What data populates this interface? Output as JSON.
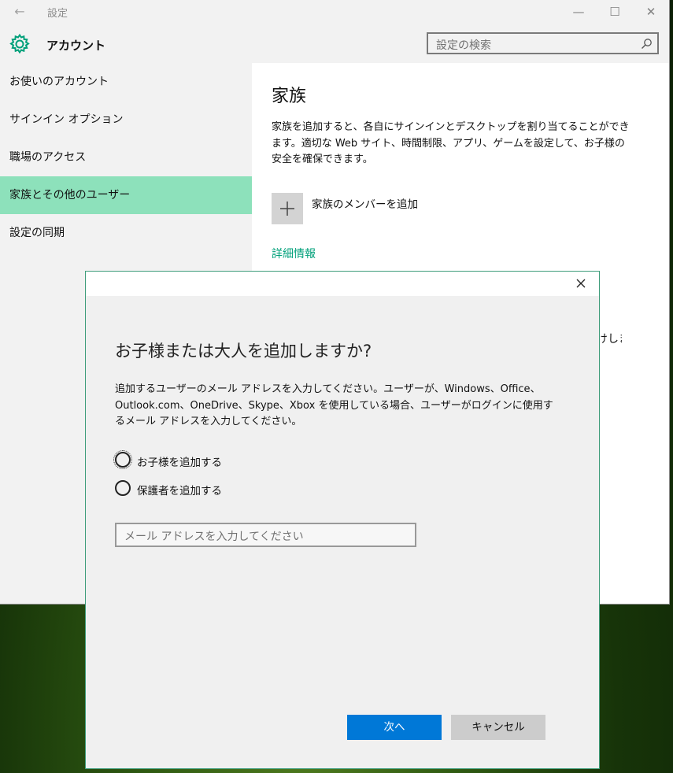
{
  "window": {
    "title": "設定",
    "back_icon": "back-arrow-icon",
    "controls": [
      "minimize-icon",
      "maximize-icon",
      "close-icon"
    ]
  },
  "header": {
    "icon": "gear-icon",
    "title": "アカウント",
    "search_placeholder": "設定の検索",
    "search_icon": "search-icon"
  },
  "sidebar": {
    "items": [
      {
        "label": "お使いのアカウント",
        "active": false
      },
      {
        "label": "サインイン オプション",
        "active": false
      },
      {
        "label": "職場のアクセス",
        "active": false
      },
      {
        "label": "家族とその他のユーザー",
        "active": true
      },
      {
        "label": "設定の同期",
        "active": false
      }
    ],
    "active_color": "#8de1bb"
  },
  "content": {
    "title": "家族",
    "description": "家族を追加すると、各自にサインインとデスクトップを割り当てることができます。適切な Web サイト、時間制限、アプリ、ゲームを設定して、お子様の安全を確保できます。",
    "add_button_label": "家族のメンバーを追加",
    "add_icon": "plus-icon",
    "more_info_link": "詳細情報",
    "partial_text": "けしま",
    "link_color": "#00a07a"
  },
  "dialog": {
    "heading": "お子様または大人を追加しますか?",
    "description": "追加するユーザーのメール アドレスを入力してください。ユーザーが、Windows、Office、Outlook.com、OneDrive、Skype、Xbox を使用している場合、ユーザーがログインに使用するメール アドレスを入力してください。",
    "options": [
      {
        "label": "お子様を追加する",
        "selected": false
      },
      {
        "label": "保護者を追加する",
        "selected": false
      }
    ],
    "email_placeholder": "メール アドレスを入力してください",
    "next_button": "次へ",
    "cancel_button": "キャンセル",
    "accent_color": "#0078d7"
  }
}
